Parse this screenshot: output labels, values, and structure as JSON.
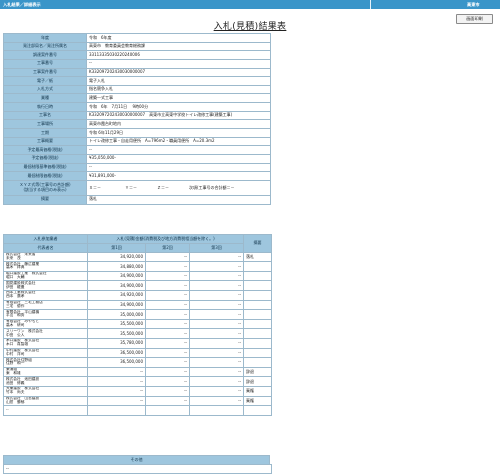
{
  "header": {
    "breadcrumb": "入札結果／詳細表示",
    "right_label": "高東市",
    "print_button": "画面印刷"
  },
  "title": "入札(見積)結果表",
  "info_rows": [
    {
      "label": "年度",
      "value": "令和　6年度"
    },
    {
      "label": "発注部局名／発注所属名",
      "value": "高東市　教育委員会教育総務課"
    },
    {
      "label": "調達案件番号",
      "value": "33113335030220240006"
    },
    {
      "label": "工事番号",
      "value": "--"
    },
    {
      "label": "工事案件番号",
      "value": "K332097202430030000007"
    },
    {
      "label": "電子／紙",
      "value": "電子入札"
    },
    {
      "label": "入札方式",
      "value": "指名競争入札"
    },
    {
      "label": "業種",
      "value": "建築一式工事"
    },
    {
      "label": "執行日時",
      "value": "令和　6年　7月11日　 9時00分"
    },
    {
      "label": "工事名",
      "value": "K332097202430030000007　高東市立高東中学校トイレ改修工事(建築工事)"
    },
    {
      "label": "工事場所",
      "value": "高東市霞台町地内"
    },
    {
      "label": "工期",
      "value": "令和 6年11月29日"
    },
    {
      "label": "工事概要",
      "value": "トイレ改修工事・自走用便所　A=796m2・職員用便所　A=20.3m2"
    },
    {
      "label": "予定最高価格(税抜)",
      "value": "--"
    },
    {
      "label": "予定価格(税抜)",
      "value": "¥35,050,000-"
    },
    {
      "label": "最低制限基準価格(税抜)",
      "value": "--"
    },
    {
      "label": "最低制限価格(税抜)",
      "value": "¥31,891,000-"
    },
    {
      "label": "ＸＹＺ式等(工事号の合計額)\n(該当する項目のみ表示)",
      "value": "Ｘ＝－　　　　　　Ｙ＝－　　　　　Ｚ＝－　　　　　次項(工事号の合計額＝－"
    },
    {
      "label": "摘要",
      "value": "落札"
    }
  ],
  "bids": {
    "col_bidder": "入札参加業者",
    "col_amount": "入札(見積)金額(消費税及び地方消費税相当額を除く。)",
    "col_remarks": "摘要",
    "col_rep": "代表者名",
    "rounds": [
      "第1回",
      "第2回",
      "第3回"
    ],
    "rows": [
      {
        "name": "株式会社　未来省\n未来　茂",
        "v1": "34,920,000",
        "v2": "--",
        "v3": "--",
        "result": "落札"
      },
      {
        "name": "株式会社　藤広建業\n高木　祥典",
        "v1": "34,880,000",
        "v2": "--",
        "v3": "--",
        "result": ""
      },
      {
        "name": "堀口建設工業　株式会社\n堀口　大輔",
        "v1": "34,900,000",
        "v2": "--",
        "v3": "--",
        "result": ""
      },
      {
        "name": "国見建設株式会社\n伊田　龍豊",
        "v1": "34,900,000",
        "v2": "--",
        "v3": "--",
        "result": ""
      },
      {
        "name": "西本工業株式会社\n西本　廣孝",
        "v1": "34,920,000",
        "v2": "--",
        "v3": "--",
        "result": ""
      },
      {
        "name": "有限会社　三宅工務店\n三宅　優作",
        "v1": "34,900,000",
        "v2": "--",
        "v3": "--",
        "result": ""
      },
      {
        "name": "有限会社　平山建機\n平山　和秀",
        "v1": "35,000,000",
        "v2": "--",
        "v3": "--",
        "result": ""
      },
      {
        "name": "有限会社　みやもと\n高木　研司",
        "v1": "35,500,000",
        "v2": "--",
        "v3": "--",
        "result": ""
      },
      {
        "name": "スリーワン　株式会社\n中田　公人",
        "v1": "35,500,000",
        "v2": "--",
        "v3": "--",
        "result": ""
      },
      {
        "name": "木口建設　株式会社\n木口　真智雄",
        "v1": "35,780,000",
        "v2": "--",
        "v3": "--",
        "result": ""
      },
      {
        "name": "中村建設　株式会社\n中村　洋司",
        "v1": "36,500,000",
        "v2": "--",
        "v3": "--",
        "result": ""
      },
      {
        "name": "株式会社住野組\n住野　和一",
        "v1": "36,500,000",
        "v2": "--",
        "v3": "--",
        "result": ""
      },
      {
        "name": "東浦組\n東　和雄",
        "v1": "--",
        "v2": "--",
        "v3": "--",
        "result": "辞退"
      },
      {
        "name": "株式会社　池田建設\n池田　修義",
        "v1": "--",
        "v2": "--",
        "v3": "--",
        "result": "辞退"
      },
      {
        "name": "大東建設　株式会社\n竹本　尚夫",
        "v1": "--",
        "v2": "--",
        "v3": "--",
        "result": "棄権"
      },
      {
        "name": "株式会社　山窓建設\n山窓　勝郁",
        "v1": "--",
        "v2": "--",
        "v3": "--",
        "result": "棄権"
      },
      {
        "name": "--",
        "v1": "",
        "v2": "",
        "v3": "",
        "result": ""
      }
    ]
  },
  "other": {
    "label": "その他",
    "value": "--"
  }
}
